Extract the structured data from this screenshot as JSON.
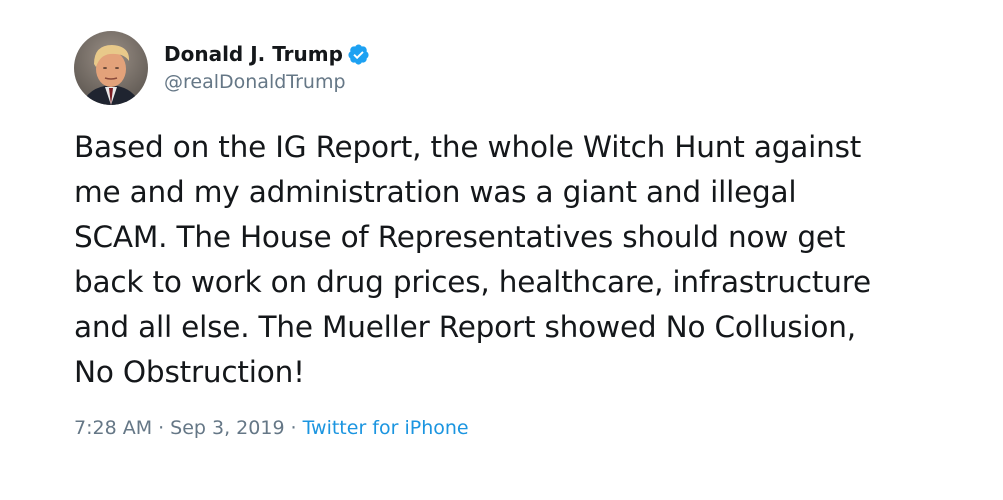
{
  "author": {
    "display_name": "Donald J. Trump",
    "handle": "@realDonaldTrump",
    "verified": true,
    "avatar_icon": "profile-photo"
  },
  "tweet": {
    "text": "Based on the IG Report, the whole Witch Hunt against\nme and my administration was a giant and illegal\nSCAM. The House of Representatives should now get\nback to work on drug prices, healthcare, infrastructure\nand all else. The Mueller Report showed No Collusion,\nNo Obstruction!",
    "time": "7:28 AM",
    "date": "Sep 3, 2019",
    "separator": "·",
    "source": "Twitter for iPhone"
  },
  "colors": {
    "text": "#14171a",
    "secondary": "#657786",
    "link": "#1b95e0",
    "verified": "#1da1f2"
  }
}
